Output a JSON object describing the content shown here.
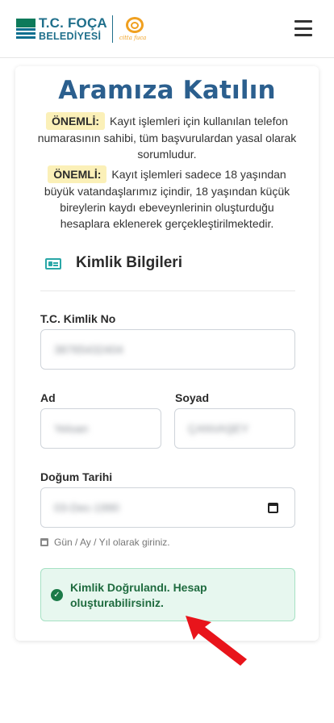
{
  "header": {
    "logo_line1": "T.C. FOÇA",
    "logo_line2": "BELEDİYESİ",
    "logo_tagline": "citta fuca"
  },
  "form": {
    "title": "Aramıza Katılın",
    "notices": [
      {
        "badge": "ÖNEMLİ:",
        "text": "Kayıt işlemleri için kullanılan telefon numarasının sahibi, tüm başvurulardan yasal olarak sorumludur."
      },
      {
        "badge": "ÖNEMLİ:",
        "text": "Kayıt işlemleri sadece 18 yaşından büyük vatandaşlarımız içindir, 18 yaşından küçük bireylerin kaydı ebeveynlerinin oluşturduğu hesaplara eklenerek gerçekleştirilmektedir."
      }
    ],
    "section_title": "Kimlik Bilgileri",
    "tc_label": "T.C. Kimlik No",
    "tc_value": "38765432404",
    "ad_label": "Ad",
    "ad_value": "Yeloan",
    "soyad_label": "Soyad",
    "soyad_value": "ÇANVAŞEY",
    "dogum_label": "Doğum Tarihi",
    "dogum_value": "03-Dec-1990",
    "date_hint": "Gün / Ay / Yıl olarak giriniz.",
    "success_message": "Kimlik Doğrulandı. Hesap oluşturabilirsiniz."
  },
  "colors": {
    "title": "#2b5f8e",
    "badge_bg": "#fbf0b8",
    "success_bg": "#e7f7ef",
    "success_text": "#1f6b3f",
    "arrow": "#e8141b"
  },
  "icons": [
    "menu-icon",
    "id-card-icon",
    "calendar-icon",
    "check-circle-icon",
    "arrow-annotation-icon"
  ]
}
